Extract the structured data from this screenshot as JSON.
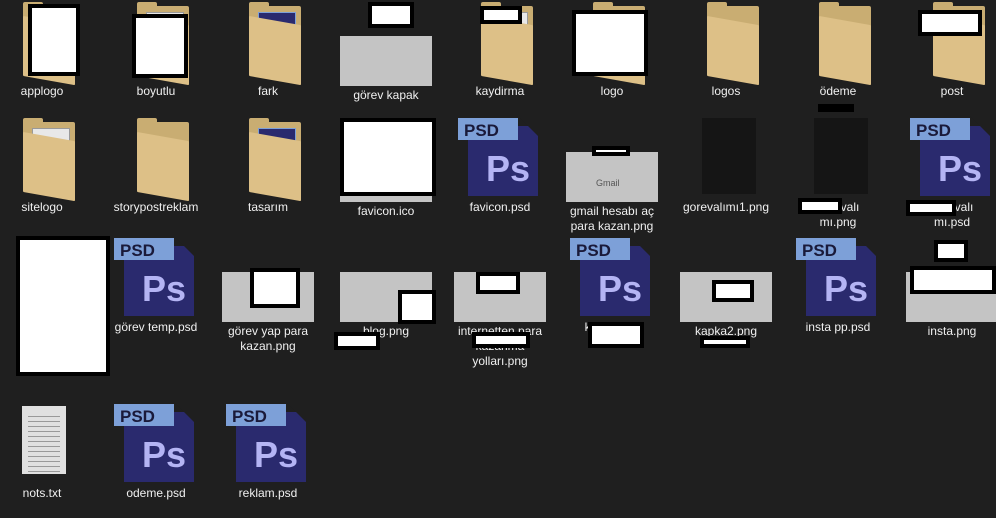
{
  "items": [
    {
      "label": "applogo",
      "type": "folder-doc"
    },
    {
      "label": "boyutlu",
      "type": "folder-doc"
    },
    {
      "label": "fark",
      "type": "folder-ps"
    },
    {
      "label": "görev kapak",
      "type": "image"
    },
    {
      "label": "kaydirma",
      "type": "folder-doc"
    },
    {
      "label": "logo",
      "type": "folder"
    },
    {
      "label": "logos",
      "type": "folder"
    },
    {
      "label": "ödeme",
      "type": "folder"
    },
    {
      "label": "post",
      "type": "folder-doc"
    },
    {
      "label": "sitelogo",
      "type": "folder-doc"
    },
    {
      "label": "storypostreklam",
      "type": "folder"
    },
    {
      "label": "tasarım",
      "type": "folder-ps"
    },
    {
      "label": "favicon.ico",
      "type": "image"
    },
    {
      "label": "favicon.psd",
      "type": "psd"
    },
    {
      "label": "gmail hesabı aç\npara kazan.png",
      "type": "image",
      "thumb_text": "Gmail"
    },
    {
      "label": "gorevalımı1.png",
      "type": "dark-image"
    },
    {
      "label": "gorevalı\nmı.png",
      "type": "dark-image"
    },
    {
      "label": "gorevalı\nmı.psd",
      "type": "psd"
    },
    {
      "label": "",
      "type": "redacted"
    },
    {
      "label": "görev temp.psd",
      "type": "psd"
    },
    {
      "label": "görev yap para\nkazan.png",
      "type": "image"
    },
    {
      "label": "blog.png",
      "type": "image"
    },
    {
      "label": "internetten para\nkazanma\nyolları.png",
      "type": "image"
    },
    {
      "label": "kapka.psd",
      "type": "psd"
    },
    {
      "label": "kapka2.png",
      "type": "image"
    },
    {
      "label": "insta pp.psd",
      "type": "psd"
    },
    {
      "label": "insta.png",
      "type": "image"
    },
    {
      "label": "nots.txt",
      "type": "txt"
    },
    {
      "label": "odeme.psd",
      "type": "psd"
    },
    {
      "label": "reklam.psd",
      "type": "psd"
    }
  ],
  "psd_badge": "PSD",
  "ps_mark": "Ps"
}
